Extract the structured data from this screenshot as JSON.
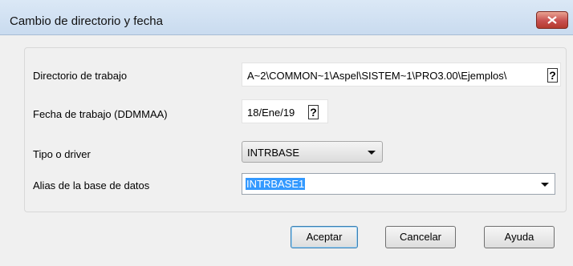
{
  "window": {
    "title": "Cambio de directorio y fecha"
  },
  "form": {
    "directory": {
      "label": "Directorio de trabajo",
      "value": "A~2\\COMMON~1\\Aspel\\SISTEM~1\\PRO3.00\\Ejemplos\\",
      "help": "?"
    },
    "date": {
      "label": "Fecha de trabajo (DDMMAA)",
      "value": "18/Ene/19",
      "help": "?"
    },
    "driver": {
      "label": "Tipo o driver",
      "value": "INTRBASE"
    },
    "alias": {
      "label": "Alias de la base de datos",
      "value": "INTRBASE1"
    }
  },
  "buttons": {
    "accept": "Aceptar",
    "cancel": "Cancelar",
    "help": "Ayuda"
  },
  "colors": {
    "selection": "#3399ff",
    "close": "#c75050"
  }
}
